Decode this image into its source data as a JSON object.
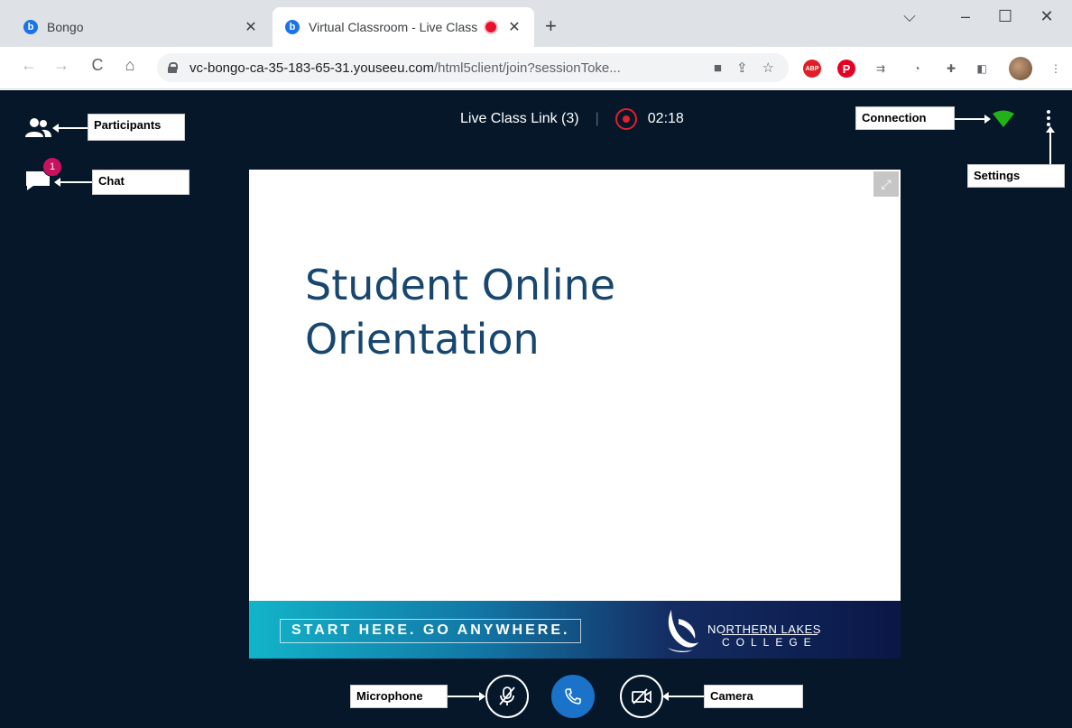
{
  "browser": {
    "tabs": [
      {
        "title": "Bongo",
        "favicon": "b",
        "active": false
      },
      {
        "title": "Virtual Classroom - Live Class",
        "favicon": "b",
        "active": true,
        "recording": true
      }
    ],
    "new_tab_glyph": "+",
    "url_host": "vc-bongo-ca-35-183-65-31.youseeu.com",
    "url_path": "/html5client/join?sessionToke...",
    "extensions": [
      "ABP",
      "P"
    ]
  },
  "header": {
    "title": "Live Class Link (3)",
    "timer": "02:18"
  },
  "sidebar": {
    "chat_badge": "1"
  },
  "slide": {
    "title_line1": "Student Online",
    "title_line2": "Orientation",
    "banner_tagline": "START HERE. GO ANYWHERE.",
    "college_name": "NORTHERN LAKES",
    "college_sub": "COLLEGE"
  },
  "annotations": {
    "participants": "Participants",
    "chat": "Chat",
    "connection": "Connection",
    "settings": "Settings",
    "microphone": "Microphone",
    "camera": "Camera"
  },
  "colors": {
    "app_bg": "#06172a",
    "slide_title": "#17466f",
    "record_red": "#e3202f",
    "connection_green": "#21b21a",
    "leave_blue": "#1a73c8",
    "chat_badge": "#c8125f"
  }
}
